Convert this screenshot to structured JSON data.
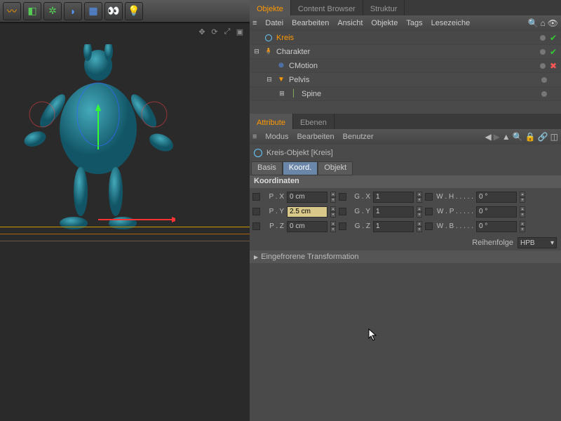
{
  "toolbar": {
    "icons": [
      "curve",
      "cube",
      "array",
      "surface",
      "floor",
      "render",
      "light"
    ]
  },
  "tabs": {
    "objects": "Objekte",
    "content": "Content Browser",
    "structure": "Struktur"
  },
  "obj_menu": {
    "file": "Datei",
    "edit": "Bearbeiten",
    "view": "Ansicht",
    "objects": "Objekte",
    "tags": "Tags",
    "bookmarks": "Lesezeiche"
  },
  "tree": [
    {
      "indent": 0,
      "exp": "",
      "name": "Kreis",
      "sel": true,
      "icon": "circle",
      "marks": [
        "dot",
        "chk"
      ]
    },
    {
      "indent": 0,
      "exp": "⊟",
      "name": "Charakter",
      "sel": false,
      "icon": "char",
      "marks": [
        "dot",
        "chk"
      ]
    },
    {
      "indent": 1,
      "exp": "",
      "name": "CMotion",
      "sel": false,
      "icon": "cmotion",
      "marks": [
        "dot",
        "x"
      ]
    },
    {
      "indent": 1,
      "exp": "⊟",
      "name": "Pelvis",
      "sel": false,
      "icon": "pelvis",
      "marks": [
        "dot",
        ""
      ]
    },
    {
      "indent": 2,
      "exp": "⊞",
      "name": "Spine",
      "sel": false,
      "icon": "spine",
      "marks": [
        "dot",
        ""
      ]
    }
  ],
  "attr_tabs": {
    "attribute": "Attribute",
    "layers": "Ebenen"
  },
  "attr_menu": {
    "mode": "Modus",
    "edit": "Bearbeiten",
    "user": "Benutzer"
  },
  "object_title": "Kreis-Objekt [Kreis]",
  "sub_tabs": {
    "basis": "Basis",
    "koord": "Koord.",
    "objekt": "Objekt"
  },
  "section": "Koordinaten",
  "coords": {
    "px": {
      "l": "P . X",
      "v": "0 cm"
    },
    "gx": {
      "l": "G . X",
      "v": "1"
    },
    "wh": {
      "l": "W . H",
      "v": "0 °"
    },
    "py": {
      "l": "P . Y",
      "v": "2.5 cm"
    },
    "gy": {
      "l": "G . Y",
      "v": "1"
    },
    "wp": {
      "l": "W . P",
      "v": "0 °"
    },
    "pz": {
      "l": "P . Z",
      "v": "0 cm"
    },
    "gz": {
      "l": "G . Z",
      "v": "1"
    },
    "wb": {
      "l": "W . B",
      "v": "0 °"
    }
  },
  "order_label": "Reihenfolge",
  "order_value": "HPB",
  "frozen": "Eingefrorene Transformation"
}
